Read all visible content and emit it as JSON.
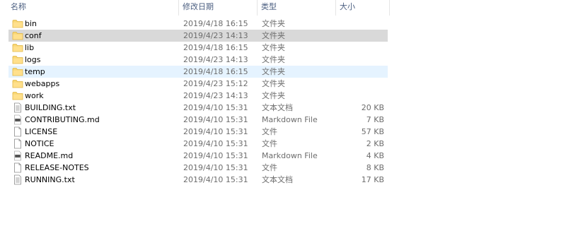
{
  "columns": {
    "name": "名称",
    "date": "修改日期",
    "type": "类型",
    "size": "大小"
  },
  "files": [
    {
      "name": "bin",
      "date": "2019/4/18 16:15",
      "type": "文件夹",
      "size": "",
      "icon": "folder-icon",
      "state": ""
    },
    {
      "name": "conf",
      "date": "2019/4/23 14:13",
      "type": "文件夹",
      "size": "",
      "icon": "folder-icon",
      "state": "selected"
    },
    {
      "name": "lib",
      "date": "2019/4/18 16:15",
      "type": "文件夹",
      "size": "",
      "icon": "folder-icon",
      "state": ""
    },
    {
      "name": "logs",
      "date": "2019/4/23 14:13",
      "type": "文件夹",
      "size": "",
      "icon": "folder-icon",
      "state": ""
    },
    {
      "name": "temp",
      "date": "2019/4/18 16:15",
      "type": "文件夹",
      "size": "",
      "icon": "folder-icon",
      "state": "hover"
    },
    {
      "name": "webapps",
      "date": "2019/4/23 15:12",
      "type": "文件夹",
      "size": "",
      "icon": "folder-icon",
      "state": ""
    },
    {
      "name": "work",
      "date": "2019/4/23 14:13",
      "type": "文件夹",
      "size": "",
      "icon": "folder-icon",
      "state": ""
    },
    {
      "name": "BUILDING.txt",
      "date": "2019/4/10 15:31",
      "type": "文本文档",
      "size": "20 KB",
      "icon": "text-document-icon",
      "state": ""
    },
    {
      "name": "CONTRIBUTING.md",
      "date": "2019/4/10 15:31",
      "type": "Markdown File",
      "size": "7 KB",
      "icon": "markdown-file-icon",
      "state": ""
    },
    {
      "name": "LICENSE",
      "date": "2019/4/10 15:31",
      "type": "文件",
      "size": "57 KB",
      "icon": "blank-file-icon",
      "state": ""
    },
    {
      "name": "NOTICE",
      "date": "2019/4/10 15:31",
      "type": "文件",
      "size": "2 KB",
      "icon": "blank-file-icon",
      "state": ""
    },
    {
      "name": "README.md",
      "date": "2019/4/10 15:31",
      "type": "Markdown File",
      "size": "4 KB",
      "icon": "markdown-file-icon",
      "state": ""
    },
    {
      "name": "RELEASE-NOTES",
      "date": "2019/4/10 15:31",
      "type": "文件",
      "size": "8 KB",
      "icon": "blank-file-icon",
      "state": ""
    },
    {
      "name": "RUNNING.txt",
      "date": "2019/4/10 15:31",
      "type": "文本文档",
      "size": "17 KB",
      "icon": "text-document-icon",
      "state": ""
    }
  ],
  "colors": {
    "header_text": "#4d6082",
    "selected_row": "#d9d9d9",
    "hover_row": "#e5f3ff",
    "folder": "#f8d775"
  }
}
